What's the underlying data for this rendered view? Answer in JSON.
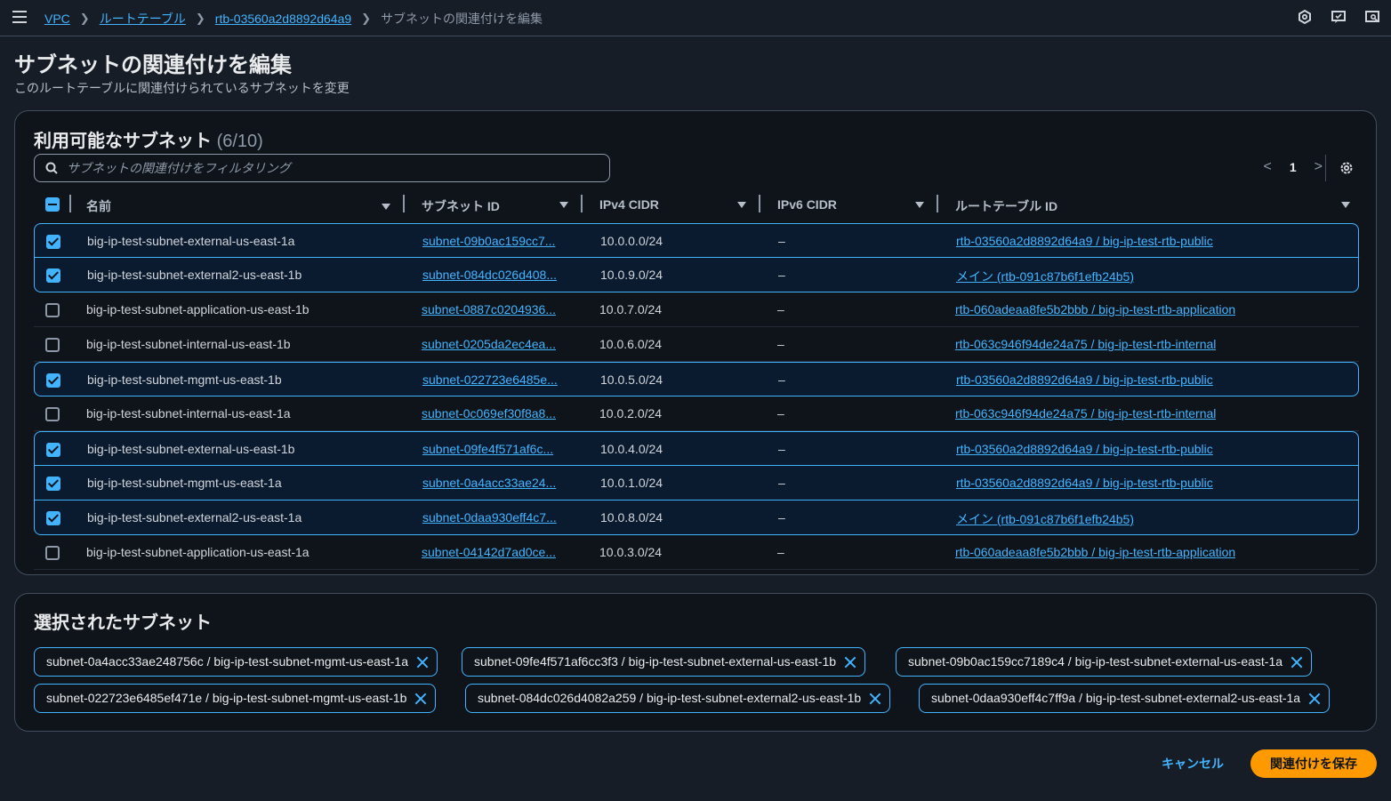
{
  "breadcrumb": {
    "items": [
      "VPC",
      "ルートテーブル",
      "rtb-03560a2d8892d64a9"
    ],
    "current": "サブネットの関連付けを編集"
  },
  "page": {
    "title": "サブネットの関連付けを編集",
    "description": "このルートテーブルに関連付けられているサブネットを変更"
  },
  "available": {
    "title": "利用可能なサブネット",
    "count": "(6/10)",
    "filter_placeholder": "サブネットの関連付けをフィルタリング",
    "page": "1",
    "columns": [
      "名前",
      "サブネット ID",
      "IPv4 CIDR",
      "IPv6 CIDR",
      "ルートテーブル ID"
    ],
    "rows": [
      {
        "selected": true,
        "name": "big-ip-test-subnet-external-us-east-1a",
        "subnet": "subnet-09b0ac159cc7...",
        "ipv4": "10.0.0.0/24",
        "ipv6": "–",
        "rtb": "rtb-03560a2d8892d64a9 / big-ip-test-rtb-public"
      },
      {
        "selected": true,
        "name": "big-ip-test-subnet-external2-us-east-1b",
        "subnet": "subnet-084dc026d408...",
        "ipv4": "10.0.9.0/24",
        "ipv6": "–",
        "rtb": "メイン (rtb-091c87b6f1efb24b5)"
      },
      {
        "selected": false,
        "name": "big-ip-test-subnet-application-us-east-1b",
        "subnet": "subnet-0887c0204936...",
        "ipv4": "10.0.7.0/24",
        "ipv6": "–",
        "rtb": "rtb-060adeaa8fe5b2bbb / big-ip-test-rtb-application"
      },
      {
        "selected": false,
        "name": "big-ip-test-subnet-internal-us-east-1b",
        "subnet": "subnet-0205da2ec4ea...",
        "ipv4": "10.0.6.0/24",
        "ipv6": "–",
        "rtb": "rtb-063c946f94de24a75 / big-ip-test-rtb-internal"
      },
      {
        "selected": true,
        "name": "big-ip-test-subnet-mgmt-us-east-1b",
        "subnet": "subnet-022723e6485e...",
        "ipv4": "10.0.5.0/24",
        "ipv6": "–",
        "rtb": "rtb-03560a2d8892d64a9 / big-ip-test-rtb-public"
      },
      {
        "selected": false,
        "name": "big-ip-test-subnet-internal-us-east-1a",
        "subnet": "subnet-0c069ef30f8a8...",
        "ipv4": "10.0.2.0/24",
        "ipv6": "–",
        "rtb": "rtb-063c946f94de24a75 / big-ip-test-rtb-internal"
      },
      {
        "selected": true,
        "name": "big-ip-test-subnet-external-us-east-1b",
        "subnet": "subnet-09fe4f571af6c...",
        "ipv4": "10.0.4.0/24",
        "ipv6": "–",
        "rtb": "rtb-03560a2d8892d64a9 / big-ip-test-rtb-public"
      },
      {
        "selected": true,
        "name": "big-ip-test-subnet-mgmt-us-east-1a",
        "subnet": "subnet-0a4acc33ae24...",
        "ipv4": "10.0.1.0/24",
        "ipv6": "–",
        "rtb": "rtb-03560a2d8892d64a9 / big-ip-test-rtb-public"
      },
      {
        "selected": true,
        "name": "big-ip-test-subnet-external2-us-east-1a",
        "subnet": "subnet-0daa930eff4c7...",
        "ipv4": "10.0.8.0/24",
        "ipv6": "–",
        "rtb": "メイン (rtb-091c87b6f1efb24b5)"
      },
      {
        "selected": false,
        "name": "big-ip-test-subnet-application-us-east-1a",
        "subnet": "subnet-04142d7ad0ce...",
        "ipv4": "10.0.3.0/24",
        "ipv6": "–",
        "rtb": "rtb-060adeaa8fe5b2bbb / big-ip-test-rtb-application"
      }
    ]
  },
  "selected_panel": {
    "title": "選択されたサブネット",
    "tokens": [
      "subnet-0a4acc33ae248756c / big-ip-test-subnet-mgmt-us-east-1a",
      "subnet-09fe4f571af6cc3f3 / big-ip-test-subnet-external-us-east-1b",
      "subnet-09b0ac159cc7189c4 / big-ip-test-subnet-external-us-east-1a",
      "subnet-022723e6485ef471e / big-ip-test-subnet-mgmt-us-east-1b",
      "subnet-084dc026d4082a259 / big-ip-test-subnet-external2-us-east-1b",
      "subnet-0daa930eff4c7ff9a / big-ip-test-subnet-external2-us-east-1a"
    ]
  },
  "actions": {
    "cancel": "キャンセル",
    "save": "関連付けを保存"
  },
  "colors": {
    "background": "#161d26",
    "panel": "#0f141a",
    "link": "#42b4ff",
    "primary_button": "#ff9900",
    "selected_row": "#0b1b2f"
  }
}
